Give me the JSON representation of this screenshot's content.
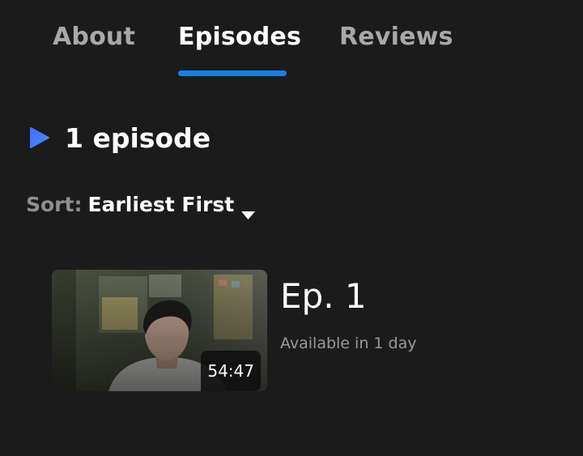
{
  "tabs": [
    {
      "label": "About",
      "active": false
    },
    {
      "label": "Episodes",
      "active": true
    },
    {
      "label": "Reviews",
      "active": false
    }
  ],
  "accent_color": "#1a7fe0",
  "episodes_header": {
    "icon": "play-icon",
    "count_text": "1 episode"
  },
  "sort": {
    "label": "Sort:",
    "value": "Earliest First",
    "icon": "caret-down-icon"
  },
  "episodes": [
    {
      "title": "Ep. 1",
      "availability": "Available in 1 day",
      "duration": "54:47"
    }
  ]
}
